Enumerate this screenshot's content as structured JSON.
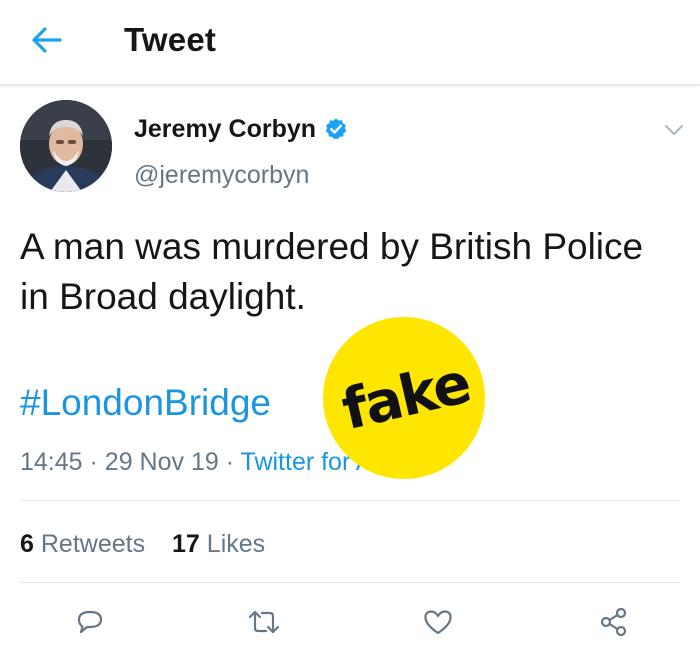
{
  "header": {
    "title": "Tweet",
    "back_icon": "arrow-left-icon"
  },
  "tweet": {
    "author_name": "Jeremy Corbyn",
    "author_handle": "@jeremycorbyn",
    "verified": true,
    "text": "A man was murdered by British Police in Broad daylight.",
    "hashtag": "#LondonBridge",
    "time": "14:45",
    "separator": "·",
    "date": "29 Nov 19",
    "client": "Twitter for Android",
    "retweets_count": "6",
    "retweets_label": "Retweets",
    "likes_count": "17",
    "likes_label": "Likes"
  },
  "sticker": {
    "text": "fake",
    "color": "#ffe600"
  },
  "actions": {
    "reply_icon": "reply-icon",
    "retweet_icon": "retweet-icon",
    "like_icon": "heart-icon",
    "share_icon": "share-icon"
  },
  "colors": {
    "accent": "#1da1f2",
    "link": "#1b95e0",
    "secondary_text": "#657786",
    "primary_text": "#14171a"
  }
}
